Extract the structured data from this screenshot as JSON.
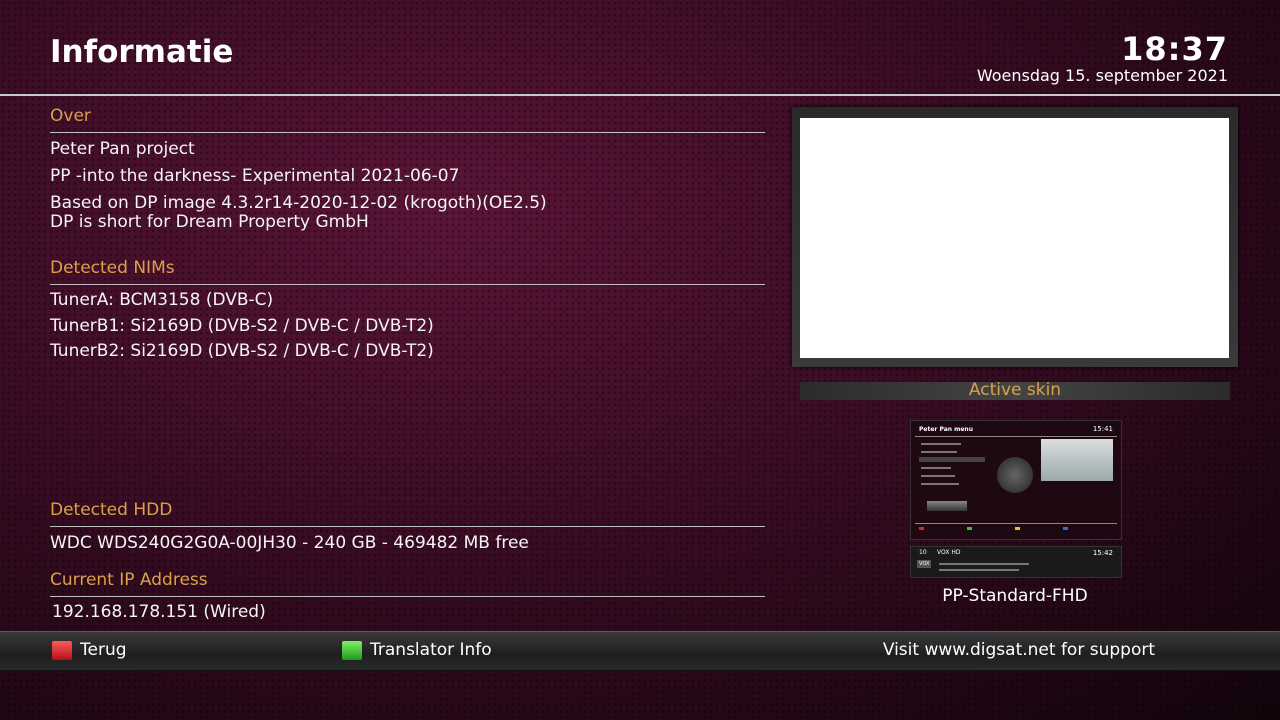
{
  "header": {
    "title": "Informatie",
    "time": "18:37",
    "date": "Woensdag 15. september  2021"
  },
  "about": {
    "heading": "Over",
    "lines": [
      "Peter Pan project",
      "PP -into the darkness- Experimental 2021-06-07",
      "Based on DP image 4.3.2r14-2020-12-02 (krogoth)(OE2.5)",
      "DP is short for Dream Property GmbH"
    ]
  },
  "nims": {
    "heading": "Detected NIMs",
    "tuners": [
      "TunerA: BCM3158 (DVB-C)",
      "TunerB1: Si2169D (DVB-S2 / DVB-C / DVB-T2)",
      "TunerB2: Si2169D (DVB-S2 / DVB-C / DVB-T2)"
    ]
  },
  "hdd": {
    "heading": "Detected HDD",
    "value": "WDC WDS240G2G0A-00JH30 - 240 GB - 469482 MB free"
  },
  "ip": {
    "heading": "Current IP Address",
    "value": "192.168.178.151 (Wired)"
  },
  "skin": {
    "heading": "Active skin",
    "name": "PP-Standard-FHD",
    "thumb": {
      "menu_title": "Peter Pan menu",
      "time": "15:41",
      "channel_num": "10",
      "channel": "VOX HD",
      "logo": "VOX",
      "info_time": "15:42"
    }
  },
  "footer": {
    "red_label": "Terug",
    "green_label": "Translator Info",
    "support": "Visit www.digsat.net for support",
    "colors": {
      "red": "#d8262b",
      "green": "#39c42a"
    }
  }
}
